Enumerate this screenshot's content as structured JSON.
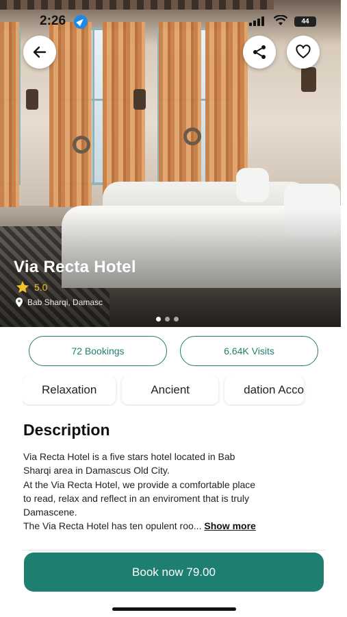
{
  "status_bar": {
    "time": "2:26",
    "battery": "44"
  },
  "hero": {
    "hotel_name": "Via Recta Hotel",
    "rating": "5.0",
    "location": "Bab Sharqi, Damasc",
    "carousel_pages": 3,
    "carousel_active": 1,
    "icons": {
      "back": "arrow-left-icon",
      "share": "share-icon",
      "favorite": "heart-icon",
      "star": "star-icon",
      "pin": "location-pin-icon"
    }
  },
  "stats": {
    "bookings": "72 Bookings",
    "visits": "6.64K Visits"
  },
  "tags": [
    "Relaxation",
    "Ancient",
    "dation Acco"
  ],
  "description": {
    "title": "Description",
    "lines": [
      "Via Recta Hotel is a five stars hotel located in Bab",
      "Sharqi area in Damascus Old City.",
      "At the Via Recta Hotel, we provide a comfortable place",
      "to read, relax and reflect in an enviroment that is truly",
      "Damascene.",
      "The Via Recta Hotel has ten opulent roo... "
    ],
    "show_more": "Show more"
  },
  "cta": {
    "label": "Book now 79.00"
  },
  "colors": {
    "accent": "#1e7f70",
    "star": "#f0c12a"
  }
}
